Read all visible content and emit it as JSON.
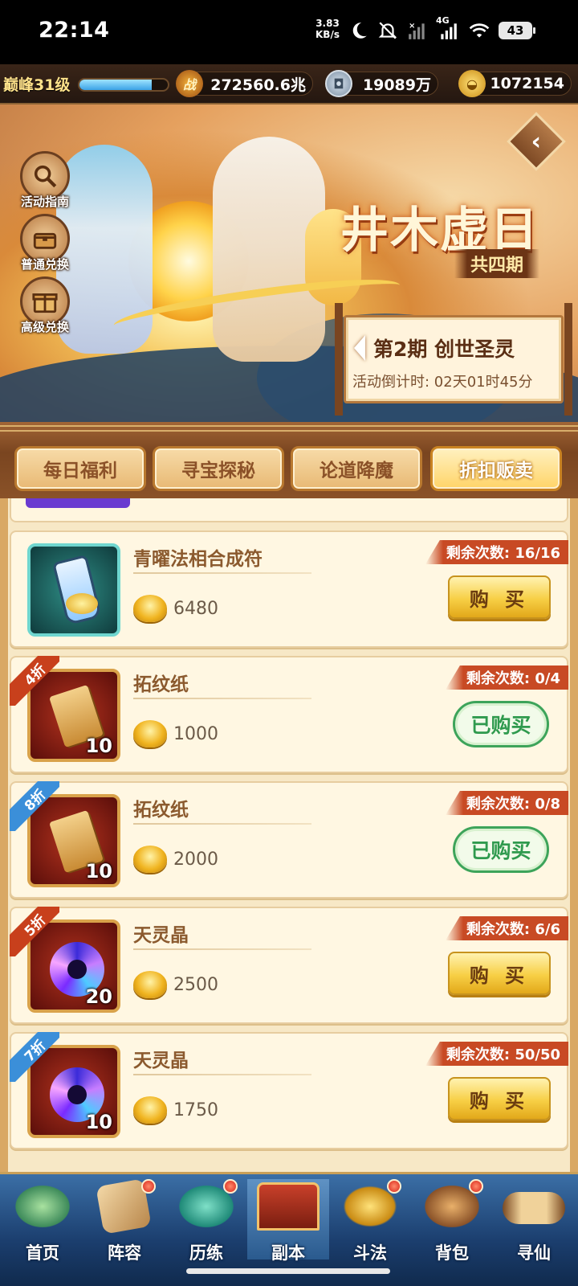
{
  "status_bar": {
    "time": "22:14",
    "net_speed_value": "3.83",
    "net_speed_unit": "KB/s",
    "network_type": "4G",
    "battery": "43"
  },
  "player": {
    "rank": "巅峰31级",
    "combat_label": "战",
    "combat_power": "272560.6兆",
    "copper_coins": "19089万",
    "gold_ingots": "1072154"
  },
  "banner": {
    "side_buttons": [
      "活动指南",
      "普通兑换",
      "高级兑换"
    ],
    "event_title": "井木虚日",
    "periods": "共四期",
    "stage": "第2期  创世圣灵",
    "countdown": "活动倒计时: 02天01时45分"
  },
  "tabs": [
    {
      "label": "每日福利",
      "active": false
    },
    {
      "label": "寻宝探秘",
      "active": false
    },
    {
      "label": "论道降魔",
      "active": false
    },
    {
      "label": "折扣贩卖",
      "active": true
    }
  ],
  "items": [
    {
      "name": "青曜法相合成符",
      "price": "6480",
      "remaining": "剩余次数: 16/16",
      "discount": "",
      "qty": "",
      "status": "buy",
      "button": "购 买"
    },
    {
      "name": "拓纹纸",
      "price": "1000",
      "remaining": "剩余次数: 0/4",
      "discount": "4折",
      "qty": "10",
      "status": "bought",
      "button": "已购买"
    },
    {
      "name": "拓纹纸",
      "price": "2000",
      "remaining": "剩余次数: 0/8",
      "discount": "8折",
      "qty": "10",
      "status": "bought",
      "button": "已购买"
    },
    {
      "name": "天灵晶",
      "price": "2500",
      "remaining": "剩余次数: 6/6",
      "discount": "5折",
      "qty": "20",
      "status": "buy",
      "button": "购 买"
    },
    {
      "name": "天灵晶",
      "price": "1750",
      "remaining": "剩余次数: 50/50",
      "discount": "7折",
      "qty": "10",
      "status": "buy",
      "button": "购 买"
    }
  ],
  "nav": [
    {
      "label": "首页",
      "badge": false
    },
    {
      "label": "阵容",
      "badge": true
    },
    {
      "label": "历练",
      "badge": true
    },
    {
      "label": "副本",
      "badge": false
    },
    {
      "label": "斗法",
      "badge": true
    },
    {
      "label": "背包",
      "badge": true
    },
    {
      "label": "寻仙",
      "badge": false
    }
  ],
  "icons": {
    "status": [
      "moon-icon",
      "silent-bell-icon",
      "signal-x-icon",
      "signal-4g-icon",
      "wifi-icon",
      "battery-icon"
    ],
    "resources": [
      "combat-icon",
      "copper-coin-icon",
      "gold-ingot-icon"
    ],
    "side_buttons": [
      "magnifier-icon",
      "chest-icon",
      "gift-icon"
    ]
  },
  "colors": {
    "accent_gold": "#f7cf45",
    "remain_tag": "#c84a24",
    "bought_green": "#2f9a4e",
    "discount_red": "#c8401c",
    "discount_blue": "#3b8fd9",
    "nav_blue": "#1b3e6e"
  },
  "level_progress": 0.82
}
